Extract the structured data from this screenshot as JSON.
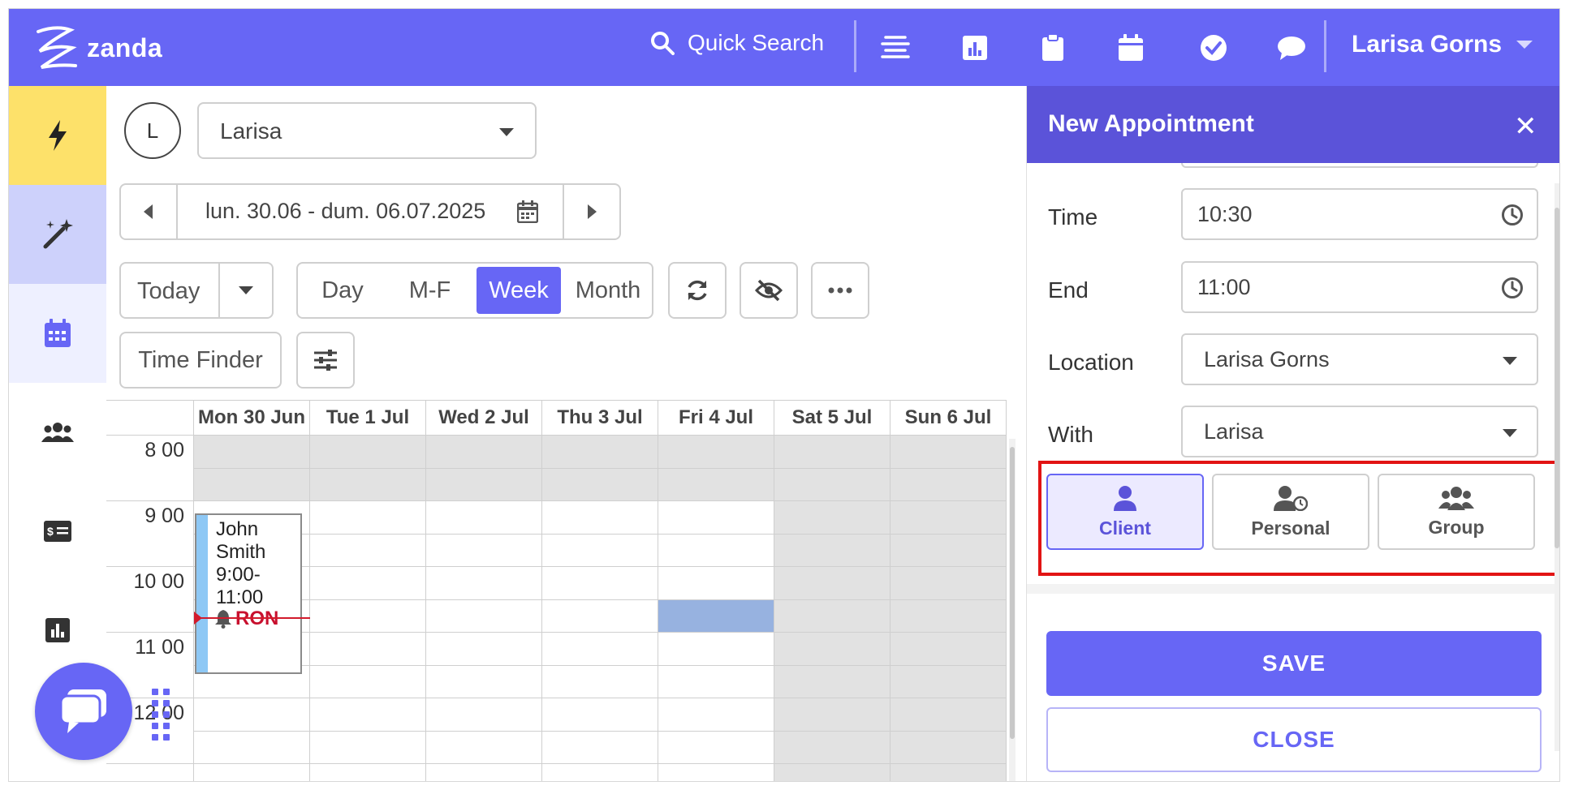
{
  "app": {
    "name": "zanda",
    "colors": {
      "accent": "#6766f5",
      "panel_header": "#5b53d9",
      "highlight": "#e21414",
      "event_bar": "#8ec8f5",
      "selected_slot": "#97b2e0",
      "weekend": "#e2e2e2"
    }
  },
  "topbar": {
    "search_label": "Quick Search",
    "icons": [
      "menu-lines-icon",
      "bar-chart-icon",
      "clipboard-icon",
      "calendar-icon",
      "check-circle-icon",
      "chat-icon"
    ],
    "user_name": "Larisa Gorns"
  },
  "rail": {
    "items": [
      "bolt-icon",
      "magic-wand-icon",
      "calendar-icon",
      "users-icon",
      "id-card-icon",
      "chart-icon",
      "chat-support-icon"
    ]
  },
  "calendar": {
    "avatar_initial": "L",
    "practitioner": "Larisa",
    "date_range": "lun. 30.06 - dum. 06.07.2025",
    "today_label": "Today",
    "views": [
      "Day",
      "M-F",
      "Week",
      "Month"
    ],
    "active_view": "Week",
    "time_finder_label": "Time Finder",
    "days": [
      "Mon 30 Jun",
      "Tue 1 Jul",
      "Wed 2 Jul",
      "Thu 3 Jul",
      "Fri 4 Jul",
      "Sat 5 Jul",
      "Sun 6 Jul"
    ],
    "hours": [
      "8 00",
      "9 00",
      "10 00",
      "11 00",
      "12 00"
    ],
    "event": {
      "title": "John Smith",
      "time": "9:00-11:00",
      "tag": "RON"
    }
  },
  "panel": {
    "title": "New Appointment",
    "fields": [
      {
        "label": "Time",
        "value": "10:30"
      },
      {
        "label": "End",
        "value": "11:00"
      },
      {
        "label": "Location",
        "value": "Larisa Gorns"
      },
      {
        "label": "With",
        "value": "Larisa"
      }
    ],
    "types": [
      {
        "label": "Client",
        "active": true
      },
      {
        "label": "Personal",
        "active": false
      },
      {
        "label": "Group",
        "active": false
      }
    ],
    "save_label": "SAVE",
    "close_label": "CLOSE"
  }
}
